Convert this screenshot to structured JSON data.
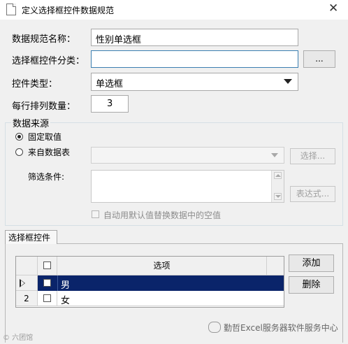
{
  "window": {
    "title": "定义选择框控件数据规范"
  },
  "form": {
    "name_label": "数据规范名称：",
    "name_value": "性别单选框",
    "category_label": "选择框控件分类：",
    "category_value": "",
    "browse_label": "...",
    "type_label": "控件类型：",
    "type_value": "单选框",
    "per_row_label": "每行排列数量：",
    "per_row_value": "3"
  },
  "source": {
    "legend": "数据来源",
    "fixed_label": "固定取值",
    "table_label": "来自数据表",
    "select_button": "选择...",
    "filter_label": "筛选条件:",
    "expr_button": "表达式...",
    "default_checkbox_label": "自动用默认值替换数据中的空值"
  },
  "tab": {
    "label": "选择框控件"
  },
  "grid": {
    "header": "选项",
    "rows": [
      {
        "num": "",
        "value": "男",
        "selected": true
      },
      {
        "num": "2",
        "value": "女",
        "selected": false
      }
    ]
  },
  "actions": {
    "add": "添加",
    "delete": "删除"
  },
  "watermark": {
    "left": "© 六团馆",
    "right": "勤哲Excel服务器软件服务中心"
  },
  "colors": {
    "selection": "#0a246a",
    "focus_border": "#3c7fb1"
  }
}
